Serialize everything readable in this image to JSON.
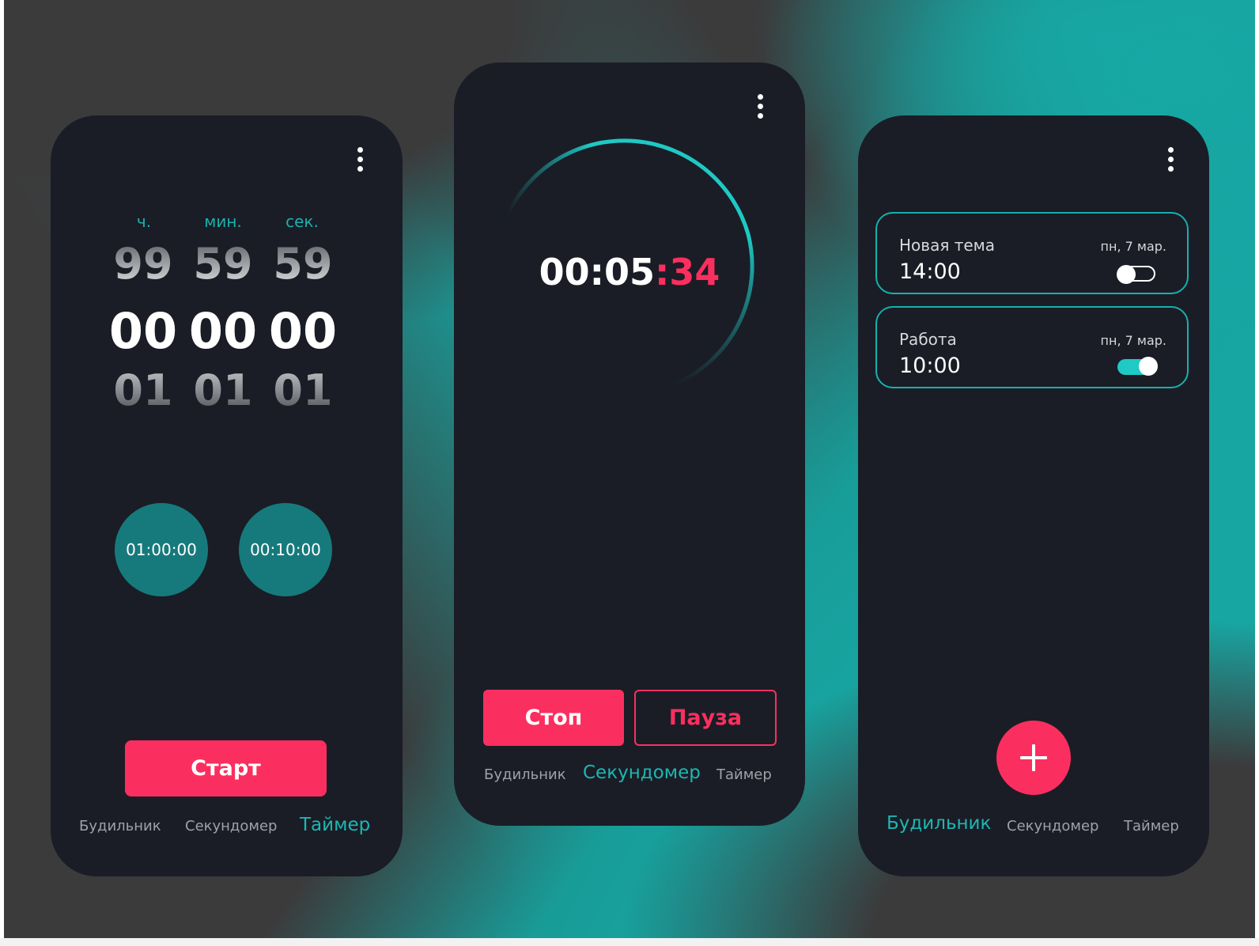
{
  "colors": {
    "accent": "#1db0ad",
    "danger": "#fb2f5f",
    "phone_bg": "#1a1d26"
  },
  "menu_icon": "more-vertical-icon",
  "timer": {
    "units": [
      "ч.",
      "мин.",
      "сек."
    ],
    "above": [
      "99",
      "59",
      "59"
    ],
    "current": [
      "00",
      "00",
      "00"
    ],
    "below": [
      "01",
      "01",
      "01"
    ],
    "presets": [
      "01:00:00",
      "00:10:00"
    ],
    "start_label": "Старт"
  },
  "stopwatch": {
    "time_main": "00:05",
    "time_sep": ":",
    "time_sec": "34",
    "stop_label": "Стоп",
    "pause_label": "Пауза"
  },
  "alarms": {
    "items": [
      {
        "name": "Новая тема",
        "date": "пн, 7 мар.",
        "time": "14:00",
        "enabled": false
      },
      {
        "name": "Работа",
        "date": "пн, 7 мар.",
        "time": "10:00",
        "enabled": true
      }
    ],
    "add_icon": "plus-icon"
  },
  "nav": {
    "alarm": "Будильник",
    "stopwatch": "Секундомер",
    "timer": "Таймер"
  }
}
